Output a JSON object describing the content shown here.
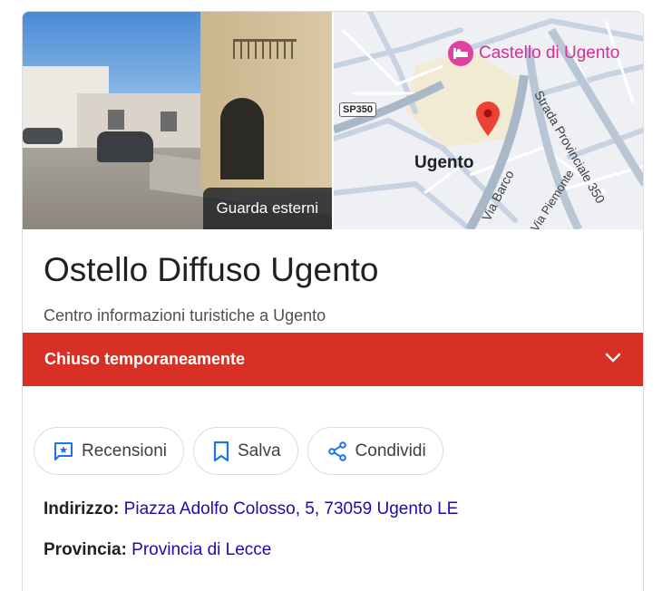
{
  "photo": {
    "label": "Guarda esterni"
  },
  "map": {
    "poi_name": "Castello di Ugento",
    "city_label": "Ugento",
    "road_shield": "SP350",
    "roads": [
      "Via Barco",
      "Strada Provinciale 350",
      "Via Piemonte"
    ]
  },
  "place": {
    "name": "Ostello Diffuso Ugento",
    "category": "Centro informazioni turistiche a Ugento"
  },
  "status": {
    "label": "Chiuso temporaneamente"
  },
  "actions": {
    "reviews": "Recensioni",
    "save": "Salva",
    "share": "Condividi"
  },
  "details": {
    "address_label": "Indirizzo:",
    "address_value": "Piazza Adolfo Colosso, 5, 73059 Ugento LE",
    "province_label": "Provincia:",
    "province_value": "Provincia di Lecce"
  },
  "colors": {
    "status_red": "#d93025",
    "link_blue": "#1a0dab",
    "poi_pink": "#d42f95",
    "action_blue": "#1a73e8"
  }
}
